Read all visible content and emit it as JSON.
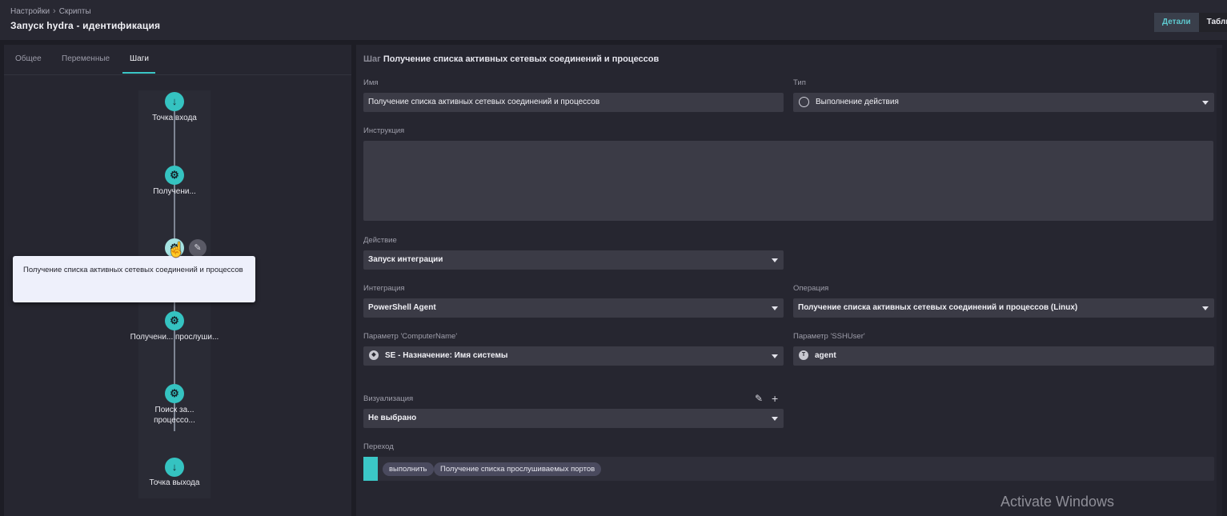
{
  "header": {
    "breadcrumb": [
      "Настройки",
      "Скрипты"
    ],
    "title": "Запуск hydra - идентификация",
    "view_tabs": [
      "Детали",
      "Табли"
    ]
  },
  "left_panel": {
    "tabs": [
      "Общее",
      "Переменные",
      "Шаги"
    ],
    "active_tab": "Шаги",
    "flow_nodes": [
      {
        "label": "Точка входа",
        "icon": "arrow-down-icon"
      },
      {
        "label": "Получени...",
        "icon": "gear-icon"
      },
      {
        "label": "",
        "icon": "gear-icon"
      },
      {
        "label": "Получени... прослуши...",
        "icon": "gear-icon"
      },
      {
        "label": "Поиск за... процессо...",
        "icon": "gear-icon"
      },
      {
        "label": "Точка выхода",
        "icon": "arrow-down-icon"
      }
    ],
    "tooltip": "Получение списка активных сетевых соединений и процессов"
  },
  "step": {
    "prefix": "Шаг",
    "title": "Получение списка активных сетевых соединений и процессов",
    "name_label": "Имя",
    "name_value": "Получение списка активных сетевых соединений и процессов",
    "type_label": "Тип",
    "type_value": "Выполнение действия",
    "instruction_label": "Инструкция",
    "instruction_value": "",
    "action_label": "Действие",
    "action_value": "Запуск интеграции",
    "integration_label": "Интеграция",
    "integration_value": "PowerShell Agent",
    "operation_label": "Операция",
    "operation_value": "Получение списка активных сетевых соединений и процессов (Linux)",
    "param1_label": "Параметр 'ComputerName'",
    "param1_value": "SE - Назначение: Имя системы",
    "param2_label": "Параметр 'SSHUser'",
    "param2_value": "agent",
    "visualization_label": "Визуализация",
    "visualization_value": "Не выбрано",
    "transition_label": "Переход",
    "transition_condition": "выполнить",
    "transition_target": "Получение списка прослушиваемых портов"
  },
  "watermark": "Activate Windows",
  "colors": {
    "accent": "#3bc7c7",
    "background": "#1d1d25",
    "panel": "#262630",
    "field": "#3b3b46"
  }
}
